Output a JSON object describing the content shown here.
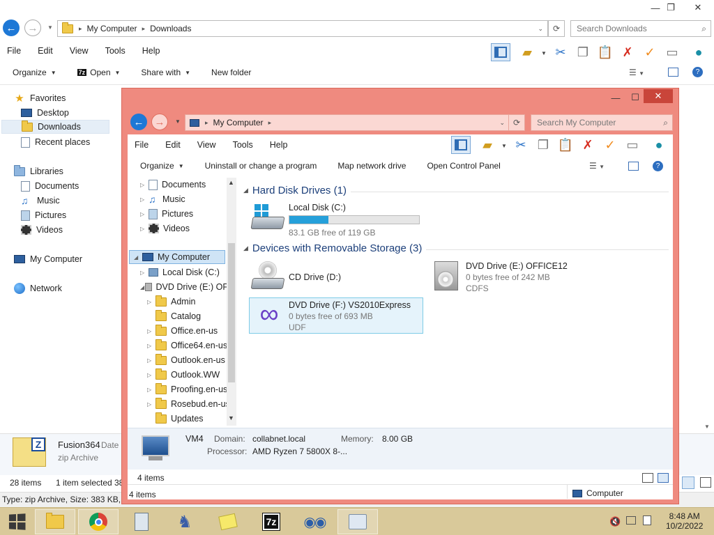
{
  "back_window": {
    "address": {
      "root": "My Computer",
      "folder": "Downloads"
    },
    "search_placeholder": "Search Downloads",
    "menu": [
      "File",
      "Edit",
      "View",
      "Tools",
      "Help"
    ],
    "commands": {
      "organize": "Organize",
      "open": "Open",
      "share": "Share with",
      "new_folder": "New folder"
    },
    "nav": {
      "favorites": "Favorites",
      "desktop": "Desktop",
      "downloads": "Downloads",
      "recent": "Recent places",
      "libraries": "Libraries",
      "documents": "Documents",
      "music": "Music",
      "pictures": "Pictures",
      "videos": "Videos",
      "computer": "My Computer",
      "network": "Network"
    },
    "details": {
      "name": "Fusion364",
      "date_label": "Date",
      "type": "zip Archive"
    },
    "status": {
      "items": "28 items",
      "selected": "1 item selected",
      "extra": "38"
    },
    "type_bar": "Type: zip Archive, Size: 383 KB, D"
  },
  "front_window": {
    "address": {
      "root": "My Computer"
    },
    "search_placeholder": "Search My Computer",
    "menu": [
      "File",
      "Edit",
      "View",
      "Tools",
      "Help"
    ],
    "commands": {
      "organize": "Organize",
      "uninstall": "Uninstall or change a program",
      "map": "Map network drive",
      "control": "Open Control Panel"
    },
    "tree": {
      "documents": "Documents",
      "music": "Music",
      "pictures": "Pictures",
      "videos": "Videos",
      "computer": "My Computer",
      "local_c": "Local Disk (C:)",
      "dvd_e": "DVD Drive (E:) OF",
      "admin": "Admin",
      "catalog": "Catalog",
      "office": "Office.en-us",
      "office64": "Office64.en-us",
      "outlook": "Outlook.en-us",
      "outlookww": "Outlook.WW",
      "proofing": "Proofing.en-us",
      "rosebud": "Rosebud.en-us",
      "updates": "Updates"
    },
    "sections": {
      "hdd": "Hard Disk Drives (1)",
      "removable": "Devices with Removable Storage (3)"
    },
    "drives": {
      "c_name": "Local Disk (C:)",
      "c_free": "83.1 GB free of 119 GB",
      "c_used_fraction": 0.3,
      "d_name": "CD Drive (D:)",
      "e_name": "DVD Drive (E:) OFFICE12",
      "e_free": "0 bytes free of 242 MB",
      "e_fs": "CDFS",
      "f_name": "DVD Drive (F:) VS2010Express",
      "f_free": "0 bytes free of 693 MB",
      "f_fs": "UDF"
    },
    "details": {
      "name": "VM4",
      "domain_label": "Domain:",
      "domain": "collabnet.local",
      "memory_label": "Memory:",
      "memory": "8.00 GB",
      "processor_label": "Processor:",
      "processor": "AMD Ryzen 7 5800X 8-..."
    },
    "status": {
      "items": "4 items",
      "items2": "4 items",
      "location": "Computer"
    }
  },
  "taskbar": {
    "time": "8:48 AM",
    "date": "10/2/2022"
  },
  "colors": {
    "front_border": "#ef8a7f",
    "taskbar": "#d9c99a",
    "accent": "#1e78d6"
  }
}
